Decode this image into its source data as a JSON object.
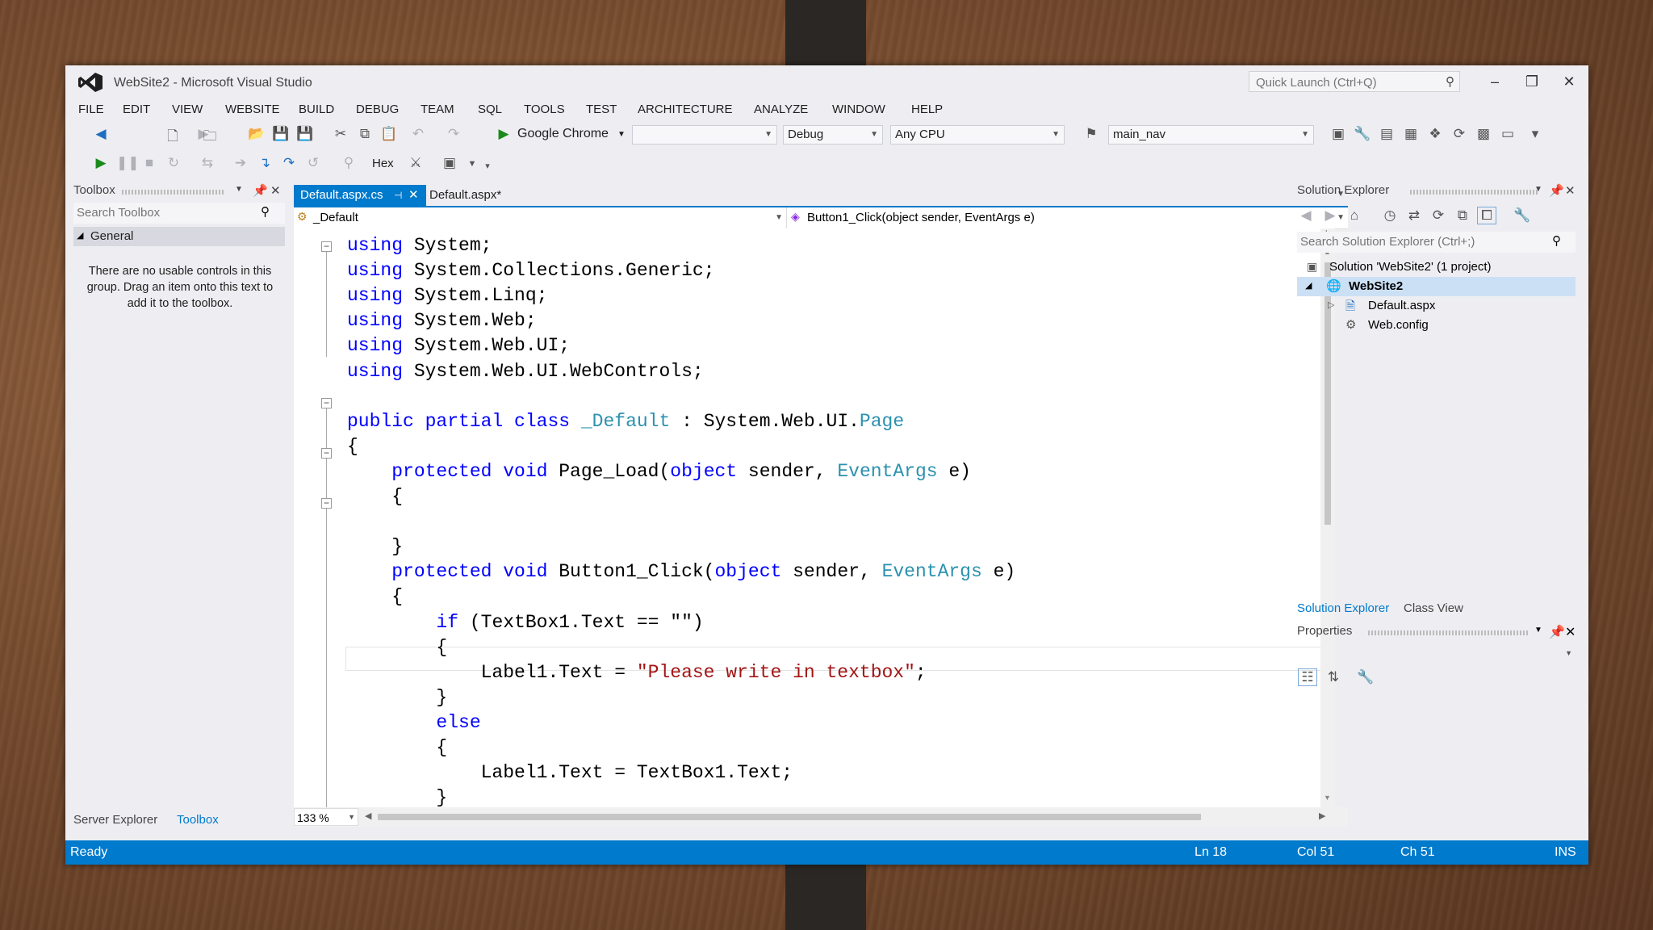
{
  "window": {
    "title": "WebSite2 - Microsoft Visual Studio",
    "quick_launch_placeholder": "Quick Launch (Ctrl+Q)"
  },
  "menu": [
    "FILE",
    "EDIT",
    "VIEW",
    "WEBSITE",
    "BUILD",
    "DEBUG",
    "TEAM",
    "SQL",
    "TOOLS",
    "TEST",
    "ARCHITECTURE",
    "ANALYZE",
    "WINDOW",
    "HELP"
  ],
  "toolbar": {
    "browser": "Google Chrome",
    "configuration": "Debug",
    "platform": "Any CPU",
    "startup": "main_nav",
    "hex_label": "Hex"
  },
  "toolbox": {
    "title": "Toolbox",
    "search_placeholder": "Search Toolbox",
    "group": "General",
    "empty_message": "There are no usable controls in this group. Drag an item onto this text to add it to the toolbox.",
    "bottom_tabs": [
      "Server Explorer",
      "Toolbox"
    ]
  },
  "editor": {
    "tabs": [
      {
        "label": "Default.aspx.cs",
        "active": true
      },
      {
        "label": "Default.aspx*",
        "active": false
      }
    ],
    "nav_class": "_Default",
    "nav_member": "Button1_Click(object sender, EventArgs e)",
    "zoom": "133 %",
    "code": [
      [
        {
          "t": "using",
          "c": "kw"
        },
        {
          "t": " System;"
        }
      ],
      [
        {
          "t": "using",
          "c": "kw"
        },
        {
          "t": " System.Collections.Generic;"
        }
      ],
      [
        {
          "t": "using",
          "c": "kw"
        },
        {
          "t": " System.Linq;"
        }
      ],
      [
        {
          "t": "using",
          "c": "kw"
        },
        {
          "t": " System.Web;"
        }
      ],
      [
        {
          "t": "using",
          "c": "kw"
        },
        {
          "t": " System.Web.UI;"
        }
      ],
      [
        {
          "t": "using",
          "c": "kw"
        },
        {
          "t": " System.Web.UI.WebControls;"
        }
      ],
      [],
      [
        {
          "t": "public partial class",
          "c": "kw"
        },
        {
          "t": " "
        },
        {
          "t": "_Default",
          "c": "ty"
        },
        {
          "t": " : System.Web.UI."
        },
        {
          "t": "Page",
          "c": "ty"
        }
      ],
      [
        {
          "t": "{"
        }
      ],
      [
        {
          "t": "    "
        },
        {
          "t": "protected void",
          "c": "kw"
        },
        {
          "t": " Page_Load("
        },
        {
          "t": "object",
          "c": "kw"
        },
        {
          "t": " sender, "
        },
        {
          "t": "EventArgs",
          "c": "ty"
        },
        {
          "t": " e)"
        }
      ],
      [
        {
          "t": "    {"
        }
      ],
      [],
      [
        {
          "t": "    }"
        }
      ],
      [
        {
          "t": "    "
        },
        {
          "t": "protected void",
          "c": "kw"
        },
        {
          "t": " Button1_Click("
        },
        {
          "t": "object",
          "c": "kw"
        },
        {
          "t": " sender, "
        },
        {
          "t": "EventArgs",
          "c": "ty"
        },
        {
          "t": " e)"
        }
      ],
      [
        {
          "t": "    {"
        }
      ],
      [
        {
          "t": "        "
        },
        {
          "t": "if",
          "c": "kw"
        },
        {
          "t": " (TextBox1.Text == \"\")"
        }
      ],
      [
        {
          "t": "        {"
        }
      ],
      [
        {
          "t": "            Label1.Text = "
        },
        {
          "t": "\"Please write in textbox\"",
          "c": "st"
        },
        {
          "t": ";"
        }
      ],
      [
        {
          "t": "        }"
        }
      ],
      [
        {
          "t": "        "
        },
        {
          "t": "else",
          "c": "kw"
        }
      ],
      [
        {
          "t": "        {"
        }
      ],
      [
        {
          "t": "            Label1.Text = TextBox1.Text;"
        }
      ],
      [
        {
          "t": "        }"
        }
      ]
    ]
  },
  "solution_explorer": {
    "title": "Solution Explorer",
    "search_placeholder": "Search Solution Explorer (Ctrl+;)",
    "solution": "Solution 'WebSite2' (1 project)",
    "project": "WebSite2",
    "files": [
      "Default.aspx",
      "Web.config"
    ],
    "bottom_tabs": [
      "Solution Explorer",
      "Class View"
    ]
  },
  "properties": {
    "title": "Properties"
  },
  "status": {
    "state": "Ready",
    "line": "Ln 18",
    "col": "Col 51",
    "ch": "Ch 51",
    "mode": "INS"
  },
  "colors": {
    "accent": "#007acc",
    "keyword": "#0000ff",
    "type": "#2b91af",
    "string": "#a31515"
  }
}
